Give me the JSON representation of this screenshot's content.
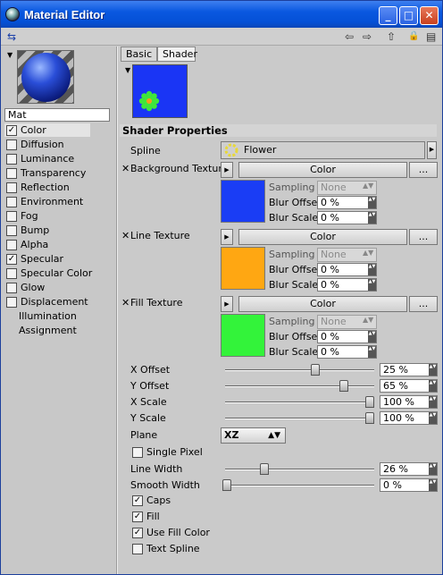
{
  "window": {
    "title": "Material Editor",
    "minimize": "_",
    "maximize": "□",
    "close": "✕"
  },
  "toolbar": {
    "left_tool": "⇆",
    "back": "⇦",
    "forward": "⇨",
    "up": "⇧",
    "lock": "🔒",
    "layout": "▤"
  },
  "material": {
    "name": "Mat"
  },
  "channels": [
    {
      "label": "Color",
      "checked": true,
      "selected": true
    },
    {
      "label": "Diffusion",
      "checked": false
    },
    {
      "label": "Luminance",
      "checked": false
    },
    {
      "label": "Transparency",
      "checked": false
    },
    {
      "label": "Reflection",
      "checked": false
    },
    {
      "label": "Environment",
      "checked": false
    },
    {
      "label": "Fog",
      "checked": false
    },
    {
      "label": "Bump",
      "checked": false
    },
    {
      "label": "Alpha",
      "checked": false
    },
    {
      "label": "Specular",
      "checked": true
    },
    {
      "label": "Specular Color",
      "checked": false
    },
    {
      "label": "Glow",
      "checked": false
    },
    {
      "label": "Displacement",
      "checked": false
    }
  ],
  "extra_items": [
    "Illumination",
    "Assignment"
  ],
  "tabs": [
    "Basic",
    "Shader"
  ],
  "section_title": "Shader Properties",
  "spline": {
    "label": "Spline",
    "value": "Flower"
  },
  "textures": [
    {
      "label": "Background Texture",
      "button": "Color",
      "more": "...",
      "color": "#1a3df5",
      "sampling_label": "Sampling",
      "sampling_value": "None",
      "blur_offset_label": "Blur Offset",
      "blur_offset": "0 %",
      "blur_scale_label": "Blur Scale",
      "blur_scale": "0 %"
    },
    {
      "label": "Line Texture",
      "button": "Color",
      "more": "...",
      "color": "#ffa712",
      "sampling_label": "Sampling",
      "sampling_value": "None",
      "blur_offset_label": "Blur Offset",
      "blur_offset": "0 %",
      "blur_scale_label": "Blur Scale",
      "blur_scale": "0 %"
    },
    {
      "label": "Fill Texture",
      "button": "Color",
      "more": "...",
      "color": "#33f33a",
      "sampling_label": "Sampling",
      "sampling_value": "None",
      "blur_offset_label": "Blur Offset",
      "blur_offset": "0 %",
      "blur_scale_label": "Blur Scale",
      "blur_scale": "0 %"
    }
  ],
  "sliders": [
    {
      "label": "X Offset",
      "value": "25 %",
      "level": 0.62
    },
    {
      "label": "Y Offset",
      "value": "65 %",
      "level": 0.82
    },
    {
      "label": "X Scale",
      "value": "100 %",
      "level": 1.0
    },
    {
      "label": "Y Scale",
      "value": "100 %",
      "level": 1.0
    }
  ],
  "plane": {
    "label": "Plane",
    "value": "XZ"
  },
  "single_pixel": {
    "label": "Single Pixel",
    "checked": false
  },
  "line_width": {
    "label": "Line Width",
    "value": "26 %",
    "level": 0.26
  },
  "smooth_width": {
    "label": "Smooth Width",
    "value": "0 %",
    "level": 0.0
  },
  "options": [
    {
      "label": "Caps",
      "checked": true
    },
    {
      "label": "Fill",
      "checked": true
    },
    {
      "label": "Use Fill Color",
      "checked": true
    },
    {
      "label": "Text Spline",
      "checked": false
    }
  ]
}
